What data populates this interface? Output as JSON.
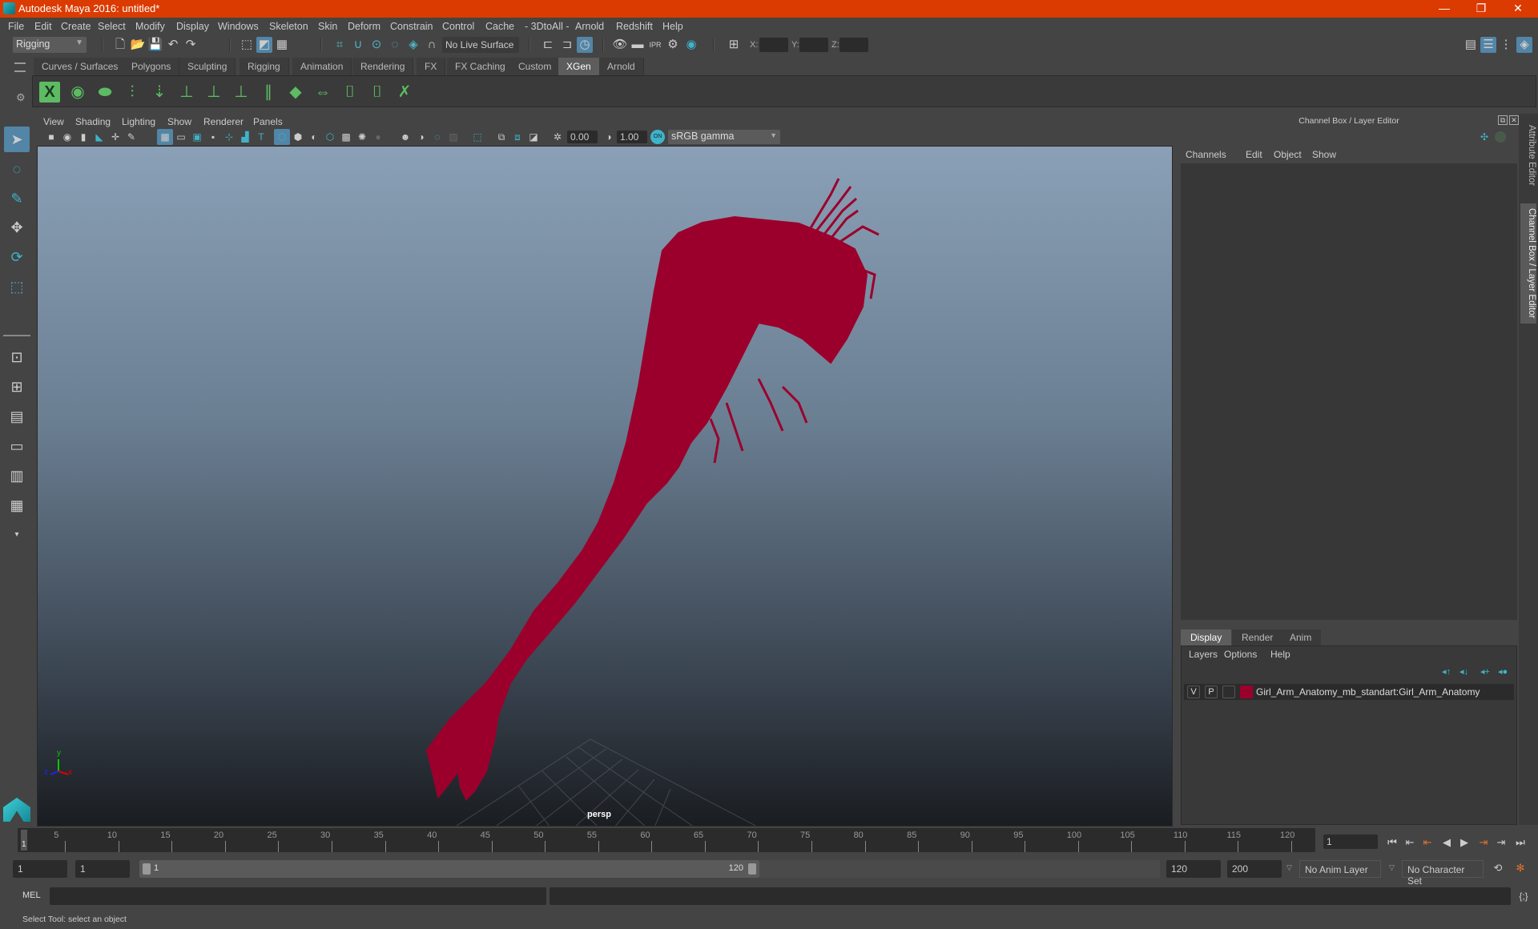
{
  "window": {
    "title": "Autodesk Maya 2016: untitled*",
    "minimize": "—",
    "restore": "❐",
    "close": "✕"
  },
  "menu": [
    "File",
    "Edit",
    "Create",
    "Select",
    "Modify",
    "Display",
    "Windows",
    "Skeleton",
    "Skin",
    "Deform",
    "Constrain",
    "Control",
    "Cache",
    "- 3DtoAll -",
    "Arnold",
    "Redshift",
    "Help"
  ],
  "statusline": {
    "menuset": "Rigging",
    "live_surface": "No Live Surface",
    "x_label": "X:",
    "y_label": "Y:",
    "z_label": "Z:",
    "x": "",
    "y": "",
    "z": ""
  },
  "shelf": {
    "tabs": [
      "Curves / Surfaces",
      "Polygons",
      "Sculpting",
      "Rigging",
      "Animation",
      "Rendering",
      "FX",
      "FX Caching",
      "Custom",
      "XGen",
      "Arnold"
    ],
    "active_tab": "XGen",
    "icons": [
      "xgen-editor-icon",
      "preview-icon",
      "clear-preview-icon",
      "add-guides-icon",
      "place-guides-icon",
      "add-guide-icon",
      "show-guide-icon",
      "lock-guide-icon",
      "split-guide-icon",
      "guide-density-icon",
      "transfer-guides-icon",
      "select-guides-icon",
      "guide-cv-icon",
      "delete-guides-icon"
    ]
  },
  "viewport": {
    "menu": [
      "View",
      "Shading",
      "Lighting",
      "Show",
      "Renderer",
      "Panels"
    ],
    "exposure": "0.00",
    "gamma": "1.00",
    "color_space": "sRGB gamma",
    "color_mgmt": "ON",
    "camera_label": "persp",
    "axis": {
      "x": "x",
      "y": "y",
      "z": "z"
    },
    "model_color": "#9b002c"
  },
  "channel_box": {
    "title": "Channel Box / Layer Editor",
    "menu": [
      "Channels",
      "Edit",
      "Object",
      "Show"
    ]
  },
  "layer_editor": {
    "tabs": [
      "Display",
      "Render",
      "Anim"
    ],
    "active_tab": "Display",
    "menu": [
      "Layers",
      "Options",
      "Help"
    ],
    "layers": [
      {
        "v": "V",
        "p": "P",
        "name": "Girl_Arm_Anatomy_mb_standart:Girl_Arm_Anatomy",
        "color": "#9b002c"
      }
    ]
  },
  "side_tabs": [
    "Attribute Editor",
    "Channel Box / Layer Editor"
  ],
  "timeline": {
    "ticks": [
      "5",
      "10",
      "15",
      "20",
      "25",
      "30",
      "35",
      "40",
      "45",
      "50",
      "55",
      "60",
      "65",
      "70",
      "75",
      "80",
      "85",
      "90",
      "95",
      "100",
      "105",
      "110",
      "115",
      "120"
    ],
    "current_frame_marker": "1",
    "current_frame": "1"
  },
  "range": {
    "start": "1",
    "anim_start": "1",
    "slider_start": "1",
    "slider_end": "120",
    "anim_end": "120",
    "end": "200",
    "anim_layer": "No Anim Layer",
    "character_set": "No Character Set"
  },
  "command_line": {
    "label": "MEL",
    "value": ""
  },
  "help_line": "Select Tool: select an object"
}
